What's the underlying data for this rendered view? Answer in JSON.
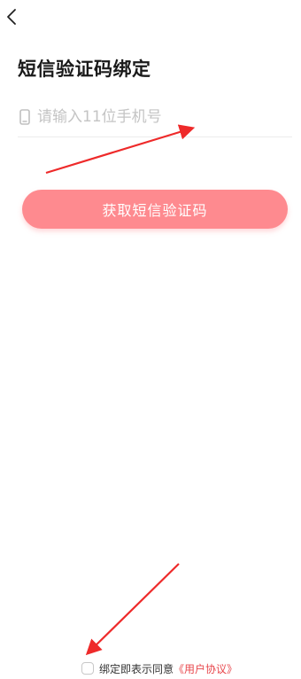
{
  "header": {
    "back_icon": "chevron-left-icon"
  },
  "title": "短信验证码绑定",
  "phone": {
    "icon": "mobile-phone-icon",
    "placeholder": "请输入11位手机号",
    "value": ""
  },
  "get_code_button": {
    "label": "获取短信验证码",
    "color": "#fe8a8f"
  },
  "agreement": {
    "checked": false,
    "prefix": "绑定即表示同意",
    "link_label": "《用户协议》",
    "link_color": "#e8474c"
  },
  "annotations": {
    "arrow_color": "#ee2a2a"
  }
}
